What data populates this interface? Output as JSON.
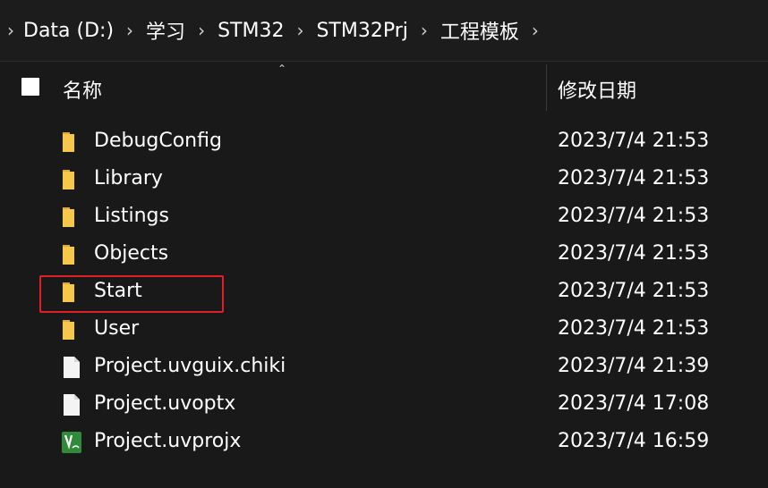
{
  "breadcrumb": [
    "Data (D:)",
    "学习",
    "STM32",
    "STM32Prj",
    "工程模板"
  ],
  "columns": {
    "name": "名称",
    "date": "修改日期"
  },
  "files": [
    {
      "name": "DebugConfig",
      "date": "2023/7/4 21:53",
      "icon": "folder-icon"
    },
    {
      "name": "Library",
      "date": "2023/7/4 21:53",
      "icon": "folder-icon"
    },
    {
      "name": "Listings",
      "date": "2023/7/4 21:53",
      "icon": "folder-icon"
    },
    {
      "name": "Objects",
      "date": "2023/7/4 21:53",
      "icon": "folder-icon"
    },
    {
      "name": "Start",
      "date": "2023/7/4 21:53",
      "icon": "folder-icon"
    },
    {
      "name": "User",
      "date": "2023/7/4 21:53",
      "icon": "folder-icon"
    },
    {
      "name": "Project.uvguix.chiki",
      "date": "2023/7/4 21:39",
      "icon": "file-icon"
    },
    {
      "name": "Project.uvoptx",
      "date": "2023/7/4 17:08",
      "icon": "file-icon"
    },
    {
      "name": "Project.uvprojx",
      "date": "2023/7/4 16:59",
      "icon": "keil-uvision-icon"
    }
  ],
  "colors": {
    "background": "#191919",
    "folder": "#f5c74a",
    "highlight": "#e01f26",
    "keil_green": "#2f8a3a"
  }
}
